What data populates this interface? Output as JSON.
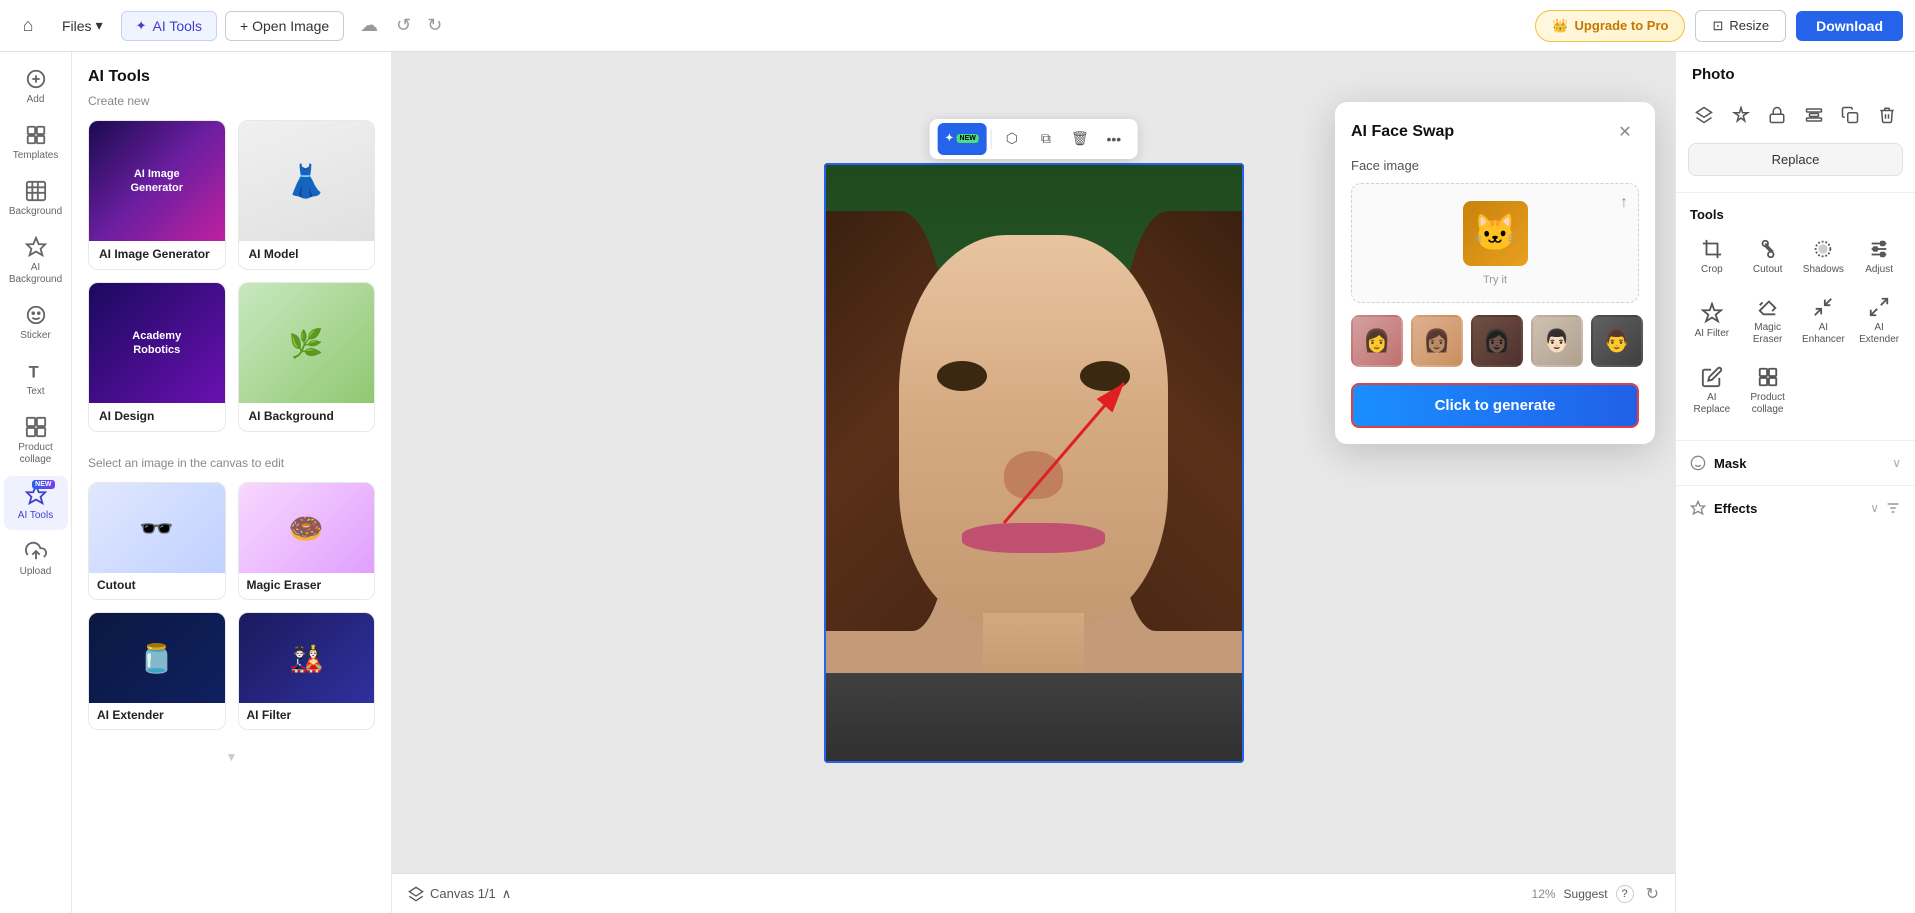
{
  "topbar": {
    "home_icon": "⌂",
    "files_label": "Files",
    "files_chevron": "▾",
    "ai_tools_label": "AI Tools",
    "open_image_label": "+ Open Image",
    "cloud_icon": "☁",
    "undo_icon": "↺",
    "redo_icon": "↻",
    "upgrade_label": "Upgrade to Pro",
    "resize_label": "Resize",
    "download_label": "Download"
  },
  "icon_sidebar": {
    "items": [
      {
        "id": "add",
        "icon": "+",
        "label": "Add"
      },
      {
        "id": "templates",
        "icon": "⊞",
        "label": "Templates"
      },
      {
        "id": "background",
        "icon": "▦",
        "label": "Background"
      },
      {
        "id": "ai-background",
        "icon": "✦",
        "label": "AI Background"
      },
      {
        "id": "sticker",
        "icon": "◎",
        "label": "Sticker"
      },
      {
        "id": "text",
        "icon": "T",
        "label": "Text"
      },
      {
        "id": "product-collage",
        "icon": "⊟",
        "label": "Product collage"
      },
      {
        "id": "ai-tools",
        "icon": "✦",
        "label": "AI Tools",
        "active": true
      },
      {
        "id": "upload",
        "icon": "↑",
        "label": "Upload"
      }
    ]
  },
  "tools_panel": {
    "title": "AI Tools",
    "subtitle": "Create new",
    "tools_create": [
      {
        "id": "ai-image-generator",
        "label": "AI Image Generator",
        "bg": "ai-image"
      },
      {
        "id": "ai-model",
        "label": "AI Model",
        "bg": "ai-model"
      },
      {
        "id": "ai-design",
        "label": "AI Design",
        "bg": "ai-design"
      },
      {
        "id": "ai-background",
        "label": "AI Background",
        "bg": "ai-background"
      }
    ],
    "select_text": "Select an image in the canvas to edit",
    "tools_edit": [
      {
        "id": "cutout",
        "label": "Cutout",
        "bg": "img-cutout"
      },
      {
        "id": "magic-eraser",
        "label": "Magic Eraser",
        "bg": "img-magic-eraser"
      },
      {
        "id": "ai-extender",
        "label": "AI Extender",
        "bg": "img-ai-extender"
      },
      {
        "id": "ai-filter",
        "label": "AI Filter",
        "bg": "img-ai-filter"
      }
    ]
  },
  "canvas": {
    "canvas_label": "Canvas 1/1",
    "zoom": "12%",
    "suggest": "Suggest",
    "help": "?"
  },
  "face_swap_modal": {
    "title": "AI Face Swap",
    "face_image_label": "Face image",
    "try_it_label": "Try it",
    "generate_label": "Click to generate",
    "close_icon": "✕",
    "samples": [
      {
        "id": "s1",
        "color": "#d4a080"
      },
      {
        "id": "s2",
        "color": "#c89060"
      },
      {
        "id": "s3",
        "color": "#705040"
      },
      {
        "id": "s4",
        "color": "#c0b0a0"
      },
      {
        "id": "s5",
        "color": "#808080"
      }
    ]
  },
  "right_panel": {
    "title": "Photo",
    "replace_label": "Replace",
    "tools_title": "Tools",
    "tools": [
      {
        "id": "crop",
        "label": "Crop"
      },
      {
        "id": "cutout",
        "label": "Cutout"
      },
      {
        "id": "shadows",
        "label": "Shadows"
      },
      {
        "id": "adjust",
        "label": "Adjust"
      },
      {
        "id": "ai-filter",
        "label": "AI Filter"
      },
      {
        "id": "magic-eraser",
        "label": "Magic Eraser"
      },
      {
        "id": "ai-enhancer",
        "label": "AI Enhancer"
      },
      {
        "id": "ai-extender",
        "label": "AI Extender"
      },
      {
        "id": "ai-replace",
        "label": "AI Replace"
      },
      {
        "id": "product-collage",
        "label": "Product collage"
      }
    ],
    "mask_label": "Mask",
    "effects_label": "Effects"
  }
}
